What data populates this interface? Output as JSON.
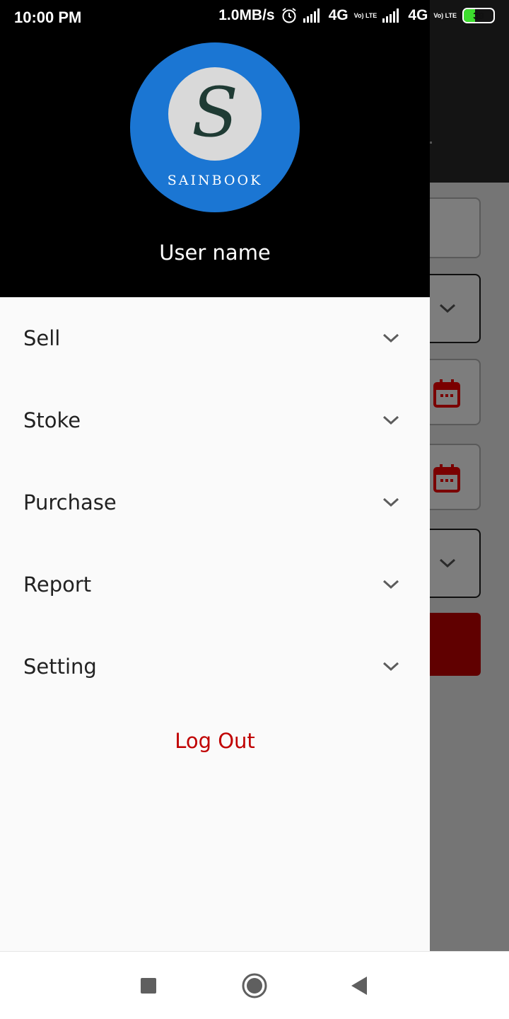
{
  "status_bar": {
    "time": "10:00 PM",
    "speed": "1.0MB/s",
    "network1": "4G",
    "network2": "4G",
    "volte": "Vo) LTE",
    "battery_level": 39,
    "battery_text": "39",
    "icons": [
      "alarm-icon",
      "signal-icon",
      "signal-icon",
      "battery-icon"
    ]
  },
  "drawer": {
    "logo": {
      "monogram": "S",
      "brand": "SAINBOOK"
    },
    "user_name": "User name",
    "menu": [
      {
        "label": "Sell",
        "icon": "chevron-down-icon"
      },
      {
        "label": "Stoke",
        "icon": "chevron-down-icon"
      },
      {
        "label": "Purchase",
        "icon": "chevron-down-icon"
      },
      {
        "label": "Report",
        "icon": "chevron-down-icon"
      },
      {
        "label": "Setting",
        "icon": "chevron-down-icon"
      }
    ],
    "logout_label": "Log Out"
  },
  "nav_bar": {
    "buttons": [
      "recents-icon",
      "home-icon",
      "back-icon"
    ]
  },
  "colors": {
    "header_bg": "#000000",
    "logo_circle": "#1b76d3",
    "logout": "#c00000",
    "drawer_bg": "#fafafa",
    "bg_button": "#600000",
    "calendar_icon": "#7a0000"
  }
}
